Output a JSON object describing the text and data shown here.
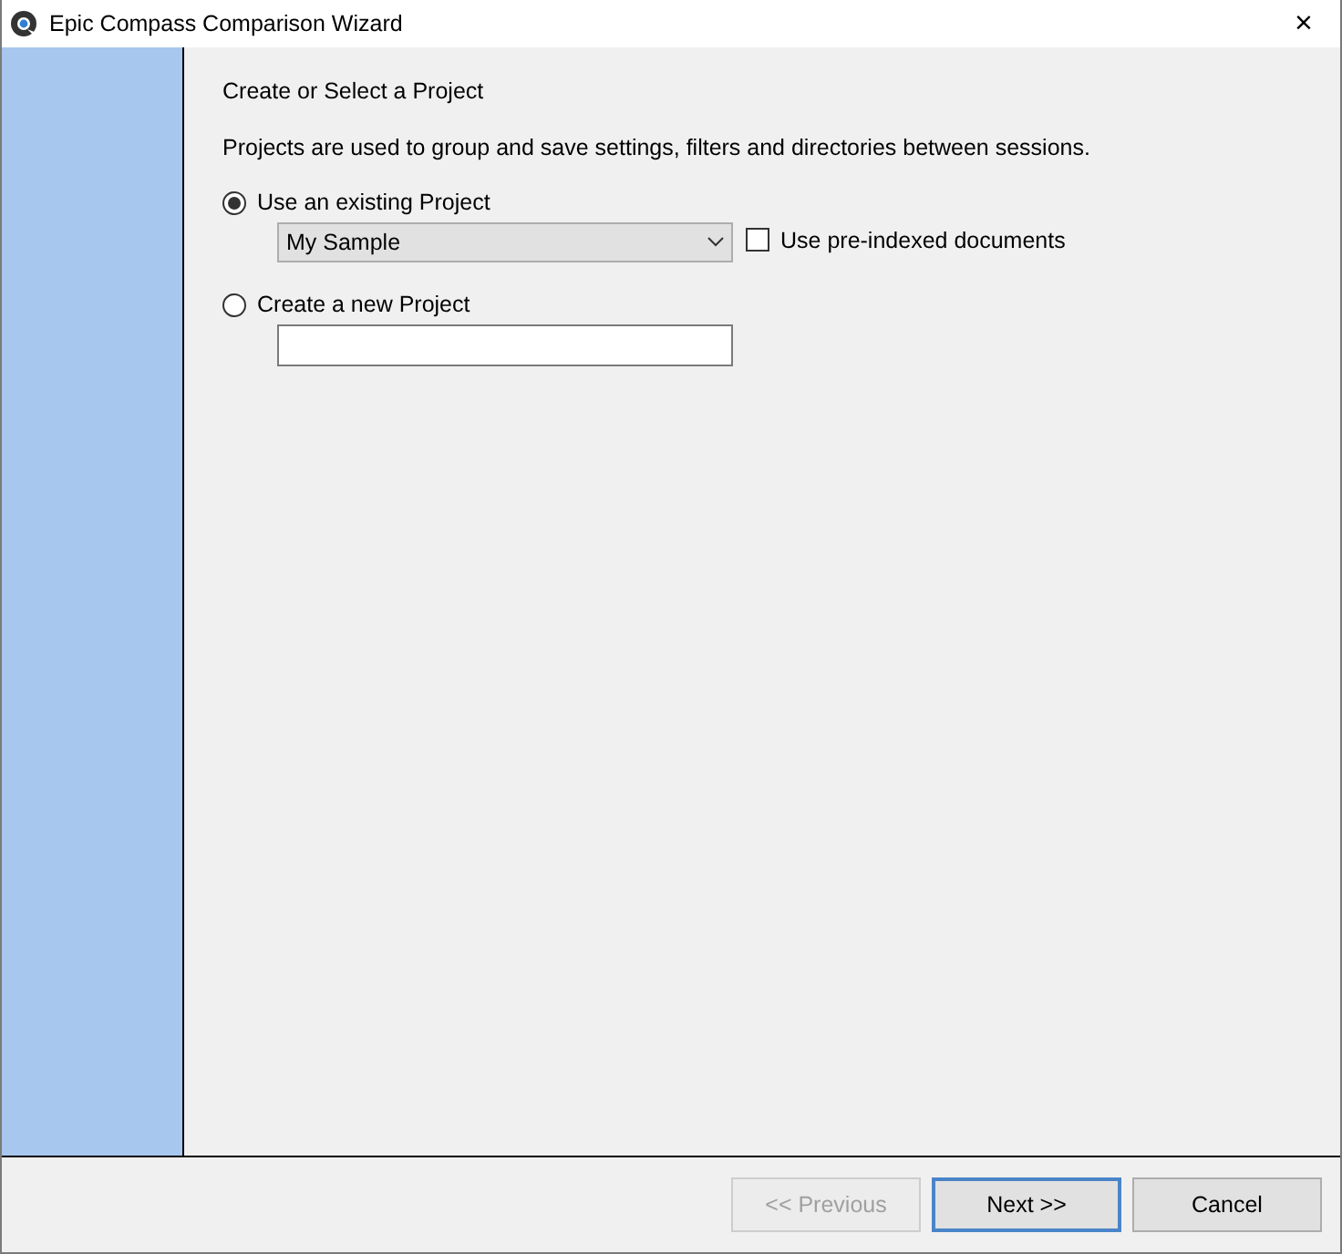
{
  "window": {
    "title": "Epic Compass Comparison Wizard",
    "close": "×"
  },
  "page": {
    "heading": "Create or Select a Project",
    "description": "Projects are used to group and save settings, filters and directories between sessions."
  },
  "options": [
    {
      "kind": "existing",
      "label": "Use an existing Project",
      "selected": true
    },
    {
      "kind": "new",
      "label": "Create a new Project",
      "selected": false
    }
  ],
  "project_dropdown": {
    "value": "My Sample"
  },
  "pre_indexed": {
    "label": "Use pre-indexed documents",
    "checked": false
  },
  "buttons": [
    {
      "label": "<< Previous",
      "disabled": true,
      "default": false
    },
    {
      "label": "Next >>",
      "disabled": false,
      "default": true
    },
    {
      "label": "Cancel",
      "disabled": false,
      "default": false
    }
  ]
}
